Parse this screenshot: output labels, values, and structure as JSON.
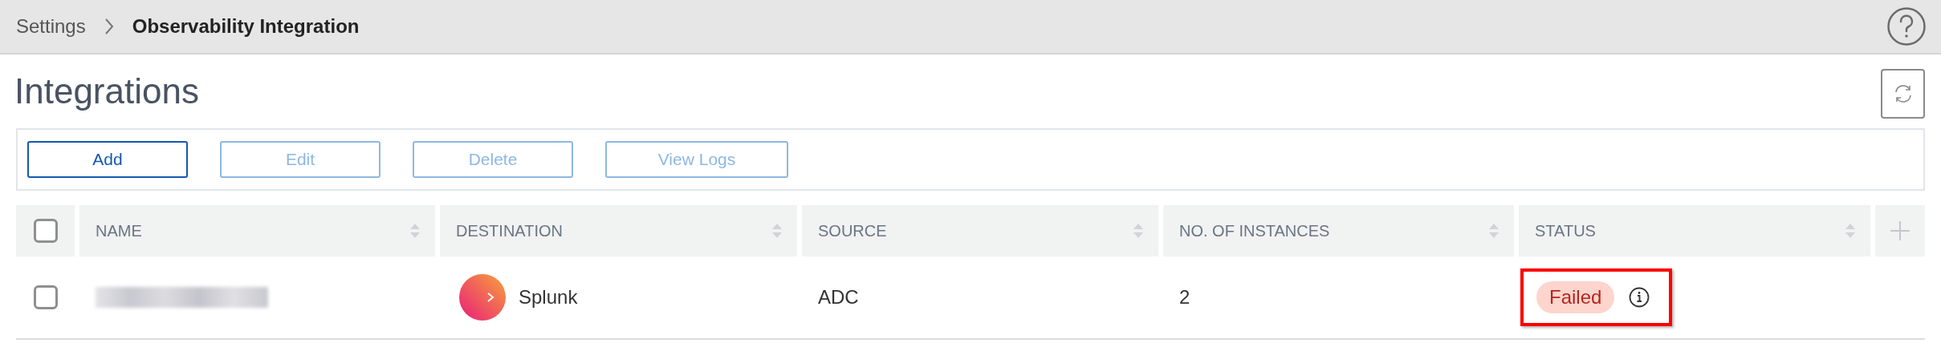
{
  "breadcrumb": [
    {
      "label": "Settings",
      "current": false
    },
    {
      "label": "Observability Integration",
      "current": true
    }
  ],
  "title": "Integrations",
  "toolbar": [
    {
      "label": "Add",
      "disabled": false
    },
    {
      "label": "Edit",
      "disabled": true
    },
    {
      "label": "Delete",
      "disabled": true
    },
    {
      "label": "View Logs",
      "disabled": true
    }
  ],
  "table": {
    "select_all": {
      "checked": false
    },
    "columns": [
      {
        "label": "NAME"
      },
      {
        "label": "DESTINATION"
      },
      {
        "label": "SOURCE"
      },
      {
        "label": "NO. OF INSTANCES"
      },
      {
        "label": "STATUS"
      }
    ],
    "rows": [
      {
        "checked": false,
        "name": {
          "redacted": true
        },
        "destination": "Splunk",
        "source": "ADC",
        "instances": "2",
        "status": {
          "label": "Failed",
          "kind": "failed",
          "highlighted": true
        }
      }
    ]
  }
}
